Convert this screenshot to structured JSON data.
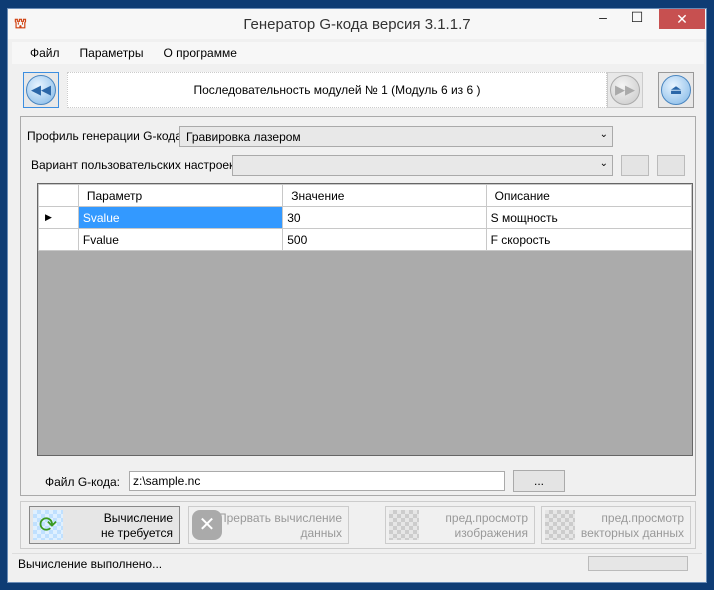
{
  "window": {
    "title": "Генератор G-кода версия 3.1.1.7",
    "minimize": "–",
    "maximize": "☐",
    "close": "✕"
  },
  "menu": [
    "Файл",
    "Параметры",
    "О программе"
  ],
  "nav": {
    "sequence": "Последовательность модулей № 1 (Модуль 6 из 6 )",
    "prev": "◀◀",
    "next": "▶▶",
    "eject": "⏏"
  },
  "profile": {
    "label": "Профиль генерации G-кода:",
    "value": "Гравировка лазером"
  },
  "variant": {
    "label": "Вариант пользовательских настроек:",
    "value": ""
  },
  "grid": {
    "columns": [
      "Параметр",
      "Значение",
      "Описание"
    ],
    "rows": [
      {
        "param": "Svalue",
        "value": "30",
        "desc": "S мощность"
      },
      {
        "param": "Fvalue",
        "value": "500",
        "desc": "F скорость"
      }
    ],
    "row_marker": "▶"
  },
  "file": {
    "label": "Файл G-кода:",
    "value": "z:\\sample.nc",
    "browse": "..."
  },
  "buttons": {
    "calc": [
      "Вычисление",
      "не требуется"
    ],
    "abort": [
      "Прервать вычисление",
      "данных"
    ],
    "preview_img": [
      "пред.просмотр",
      "изображения"
    ],
    "preview_vec": [
      "пред.просмотр",
      "векторных данных"
    ]
  },
  "status": "Вычисление выполнено..."
}
